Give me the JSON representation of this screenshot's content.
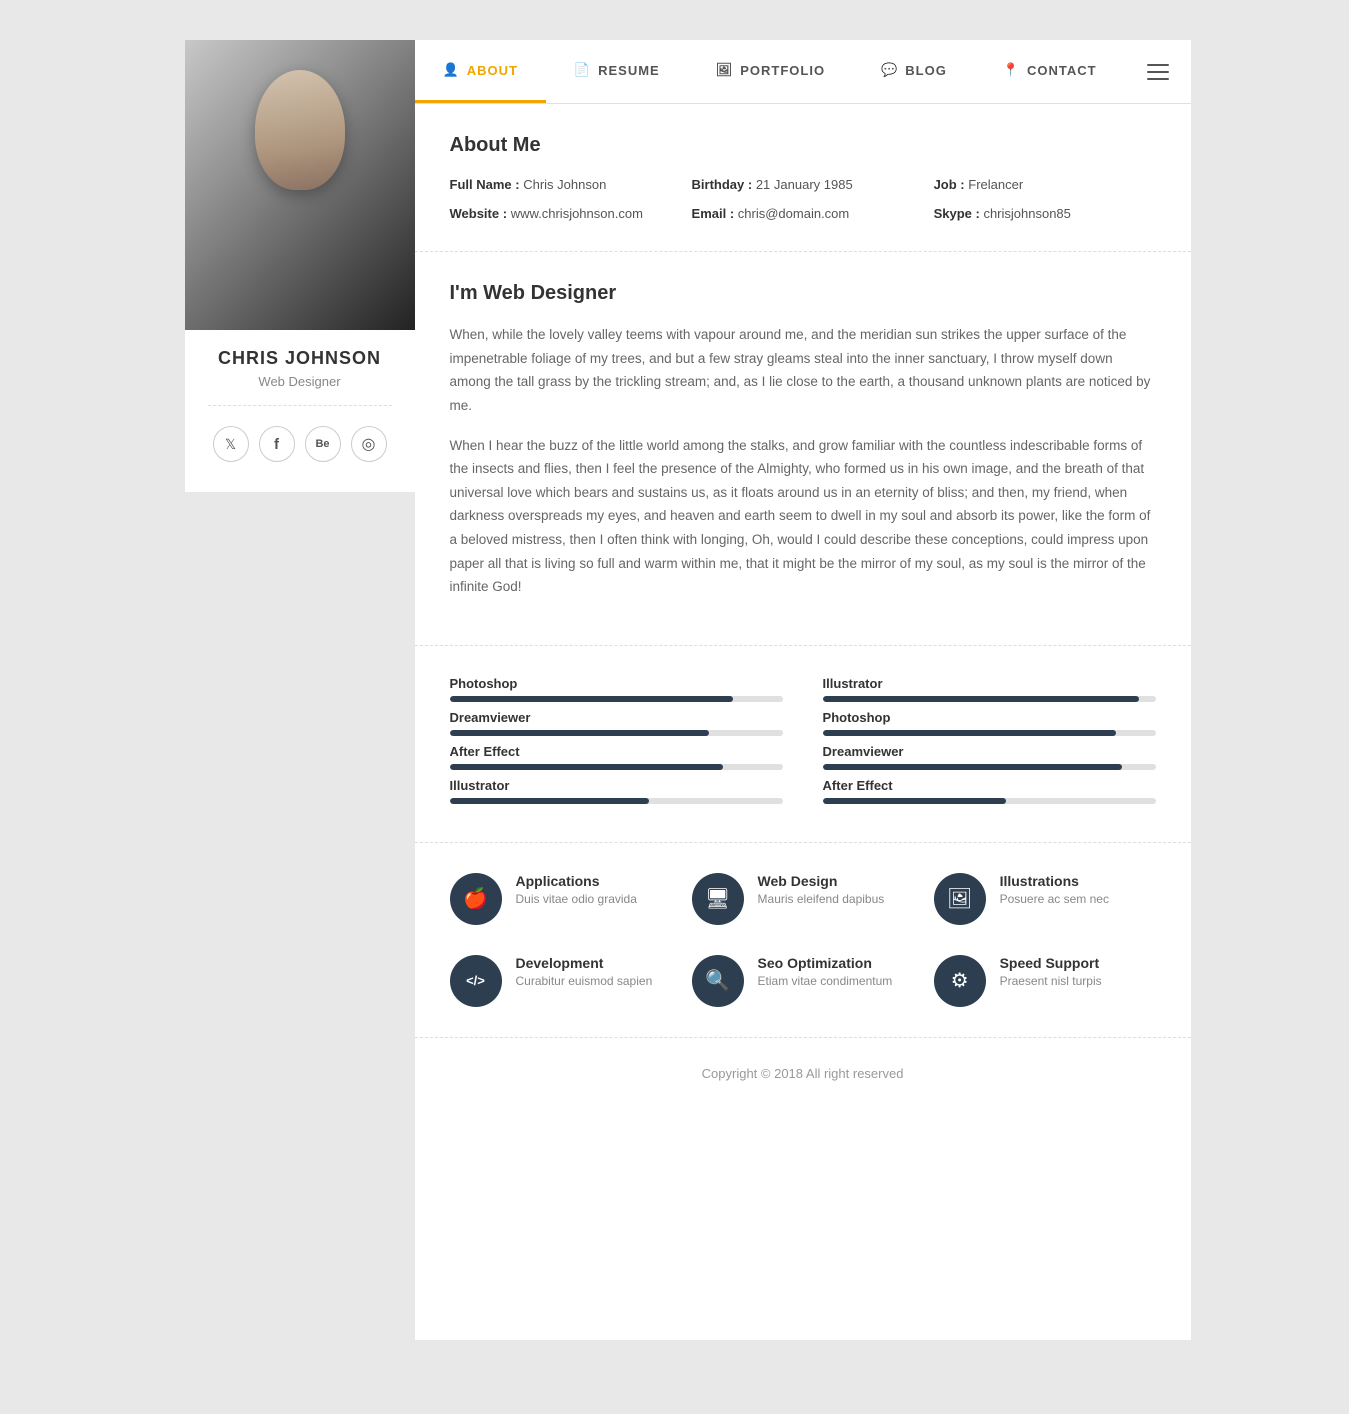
{
  "sidebar": {
    "name": "CHRIS JOHNSON",
    "title": "Web Designer",
    "social": [
      {
        "icon": "🐦",
        "name": "twitter",
        "label": "Twitter"
      },
      {
        "icon": "f",
        "name": "facebook",
        "label": "Facebook"
      },
      {
        "icon": "Be",
        "name": "behance",
        "label": "Behance"
      },
      {
        "icon": "◉",
        "name": "dribbble",
        "label": "Dribbble"
      }
    ]
  },
  "nav": {
    "items": [
      {
        "label": "ABOUT",
        "icon": "👤",
        "active": true
      },
      {
        "label": "RESUME",
        "icon": "📄",
        "active": false
      },
      {
        "label": "PORTFOLIO",
        "icon": "🖼",
        "active": false
      },
      {
        "label": "BLOG",
        "icon": "💬",
        "active": false
      },
      {
        "label": "CONTACT",
        "icon": "📍",
        "active": false
      }
    ]
  },
  "about": {
    "section_title": "About Me",
    "fields": [
      {
        "label": "Full Name :",
        "value": "Chris Johnson"
      },
      {
        "label": "Birthday :",
        "value": "21 January 1985"
      },
      {
        "label": "Job :",
        "value": "Frelancer"
      },
      {
        "label": "Website :",
        "value": "www.chrisjohnson.com"
      },
      {
        "label": "Email :",
        "value": "chris@domain.com"
      },
      {
        "label": "Skype :",
        "value": "chrisjohnson85"
      }
    ]
  },
  "bio": {
    "title": "I'm Web Designer",
    "paragraphs": [
      "When, while the lovely valley teems with vapour around me, and the meridian sun strikes the upper surface of the impenetrable foliage of my trees, and but a few stray gleams steal into the inner sanctuary, I throw myself down among the tall grass by the trickling stream; and, as I lie close to the earth, a thousand unknown plants are noticed by me.",
      "When I hear the buzz of the little world among the stalks, and grow familiar with the countless indescribable forms of the insects and flies, then I feel the presence of the Almighty, who formed us in his own image, and the breath of that universal love which bears and sustains us, as it floats around us in an eternity of bliss; and then, my friend, when darkness overspreads my eyes, and heaven and earth seem to dwell in my soul and absorb its power, like the form of a beloved mistress, then I often think with longing, Oh, would I could describe these conceptions, could impress upon paper all that is living so full and warm within me, that it might be the mirror of my soul, as my soul is the mirror of the infinite God!"
    ]
  },
  "skills": {
    "left": [
      {
        "label": "Photoshop",
        "percent": 85
      },
      {
        "label": "Dreamviewer",
        "percent": 78
      },
      {
        "label": "After Effect",
        "percent": 82
      },
      {
        "label": "Illustrator",
        "percent": 60
      }
    ],
    "right": [
      {
        "label": "Illustrator",
        "percent": 95
      },
      {
        "label": "Photoshop",
        "percent": 88
      },
      {
        "label": "Dreamviewer",
        "percent": 90
      },
      {
        "label": "After Effect",
        "percent": 55
      }
    ]
  },
  "services": {
    "items": [
      {
        "icon": "🍎",
        "name": "Applications",
        "desc": "Duis vitae odio gravida"
      },
      {
        "icon": "🖥",
        "name": "Web Design",
        "desc": "Mauris eleifend dapibus"
      },
      {
        "icon": "🖼",
        "name": "Illustrations",
        "desc": "Posuere ac sem nec"
      },
      {
        "icon": "</>",
        "name": "Development",
        "desc": "Curabitur euismod sapien"
      },
      {
        "icon": "🔍",
        "name": "Seo Optimization",
        "desc": "Etiam vitae condimentum"
      },
      {
        "icon": "⚙",
        "name": "Speed Support",
        "desc": "Praesent nisl turpis"
      }
    ]
  },
  "footer": {
    "text": "Copyright © 2018 All right reserved"
  }
}
